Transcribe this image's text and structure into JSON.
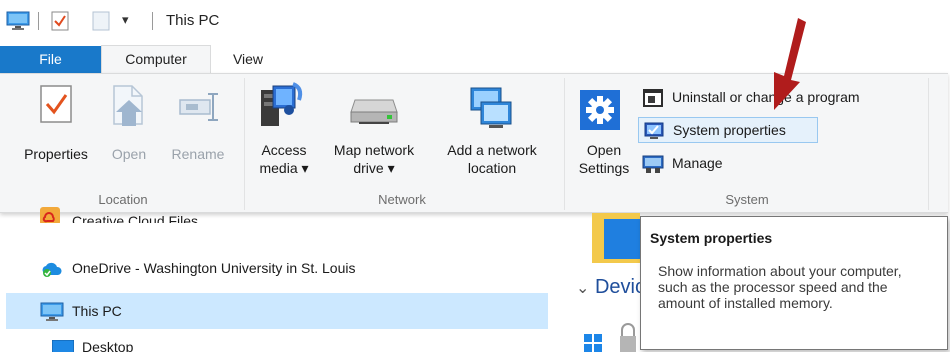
{
  "window": {
    "title": "This PC"
  },
  "quick_access": {
    "dropdown_glyph": "▾"
  },
  "tabs": [
    {
      "label": "File",
      "active": false
    },
    {
      "label": "Computer",
      "active": true
    },
    {
      "label": "View",
      "active": false
    }
  ],
  "ribbon": {
    "location": {
      "label": "Location",
      "buttons": [
        {
          "line1": "Properties",
          "enabled": true
        },
        {
          "line1": "Open",
          "enabled": false
        },
        {
          "line1": "Rename",
          "enabled": false
        }
      ]
    },
    "network": {
      "label": "Network",
      "buttons": [
        {
          "line1": "Access",
          "line2": "media ▾"
        },
        {
          "line1": "Map network",
          "line2": "drive ▾"
        },
        {
          "line1": "Add a network",
          "line2": "location"
        }
      ]
    },
    "system": {
      "label": "System",
      "open_settings": {
        "line1": "Open",
        "line2": "Settings"
      },
      "small_buttons": [
        {
          "label": "Uninstall or change a program"
        },
        {
          "label": "System properties",
          "highlighted": true
        },
        {
          "label": "Manage"
        }
      ]
    }
  },
  "nav_pane": {
    "items": [
      {
        "label": "Creative Cloud Files"
      },
      {
        "label": "OneDrive - Washington University in St. Louis"
      },
      {
        "label": "This PC",
        "selected": true
      },
      {
        "label": "Desktop"
      }
    ]
  },
  "content": {
    "devices_label": "Devic"
  },
  "tooltip": {
    "title": "System properties",
    "body": "Show information about your computer, such as the processor speed and the amount of installed memory."
  },
  "colors": {
    "file_tab": "#1979ca",
    "selection": "#cce8ff",
    "highlight_border": "#99c8f0",
    "annotation_arrow": "#b01c1c"
  }
}
